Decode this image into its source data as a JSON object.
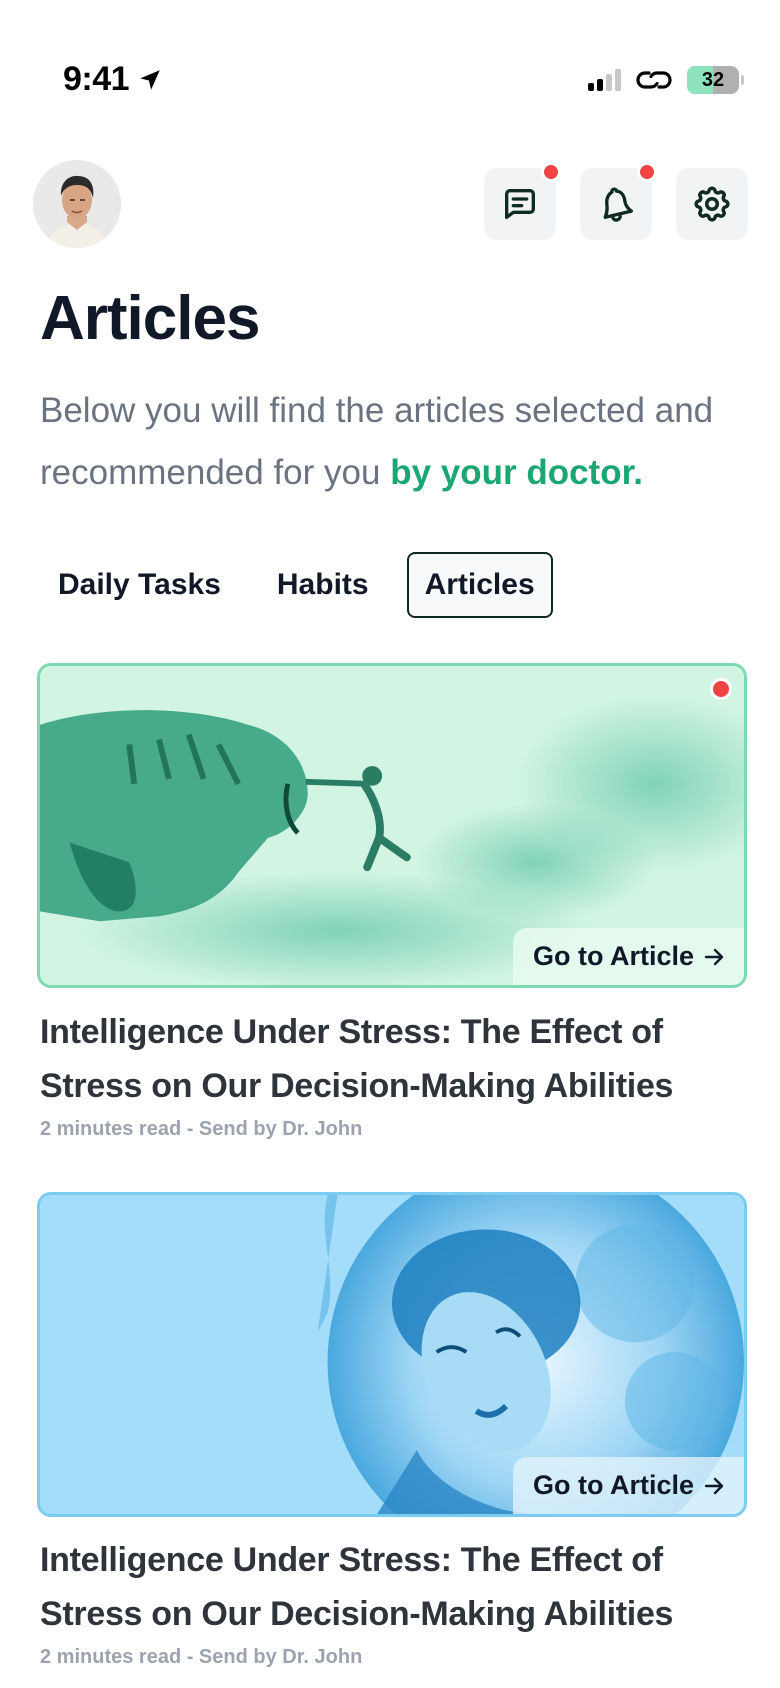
{
  "status_bar": {
    "time": "9:41",
    "battery_level": "32",
    "battery_fraction": 0.5,
    "icons": [
      "location-arrow-icon",
      "signal-icon",
      "link-icon",
      "battery-icon"
    ]
  },
  "header": {
    "avatar_alt": "User avatar",
    "buttons": [
      {
        "name": "messages",
        "icon": "message-icon",
        "has_badge": true
      },
      {
        "name": "notifications",
        "icon": "bell-icon",
        "has_badge": true
      },
      {
        "name": "settings",
        "icon": "gear-icon",
        "has_badge": false
      }
    ]
  },
  "page": {
    "title": "Articles",
    "description": "Below you will find the articles selected and recommended for you",
    "description_highlight": "by your doctor.",
    "highlight_color": "#1aa772"
  },
  "tabs": [
    {
      "label": "Daily Tasks",
      "active": false
    },
    {
      "label": "Habits",
      "active": false
    },
    {
      "label": "Articles",
      "active": true
    }
  ],
  "articles": [
    {
      "image_theme": "green watercolor tiger and child",
      "unread": true,
      "cta": "Go to Article",
      "cta_icon": "arrow-right-icon",
      "title": "Intelligence Under Stress: The Effect of Stress on Our Decision-Making Abilities",
      "meta": "2 minutes read - Send by Dr. John"
    },
    {
      "image_theme": "blue watercolor woman sleeping on moon",
      "unread": false,
      "cta": "Go to Article",
      "cta_icon": "arrow-right-icon",
      "title": "Intelligence Under Stress: The Effect of Stress on Our Decision-Making Abilities",
      "meta": "2 minutes read - Send by Dr. John"
    }
  ]
}
